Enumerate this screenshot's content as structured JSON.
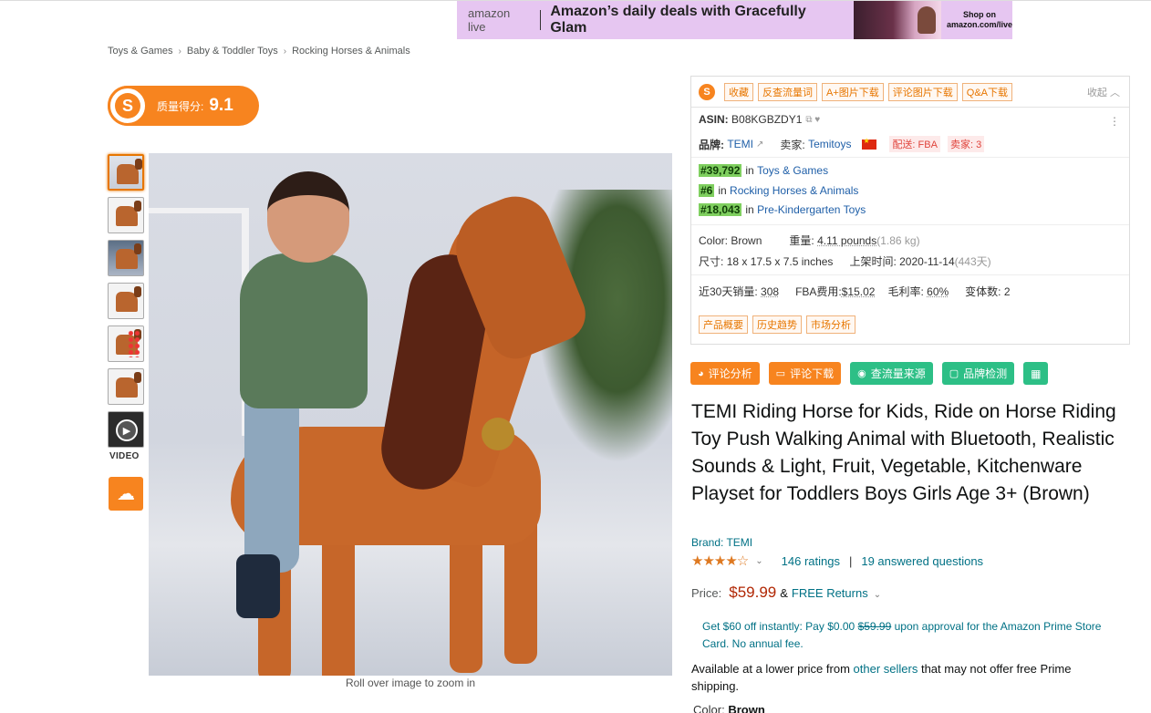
{
  "banner": {
    "brand": "amazon",
    "brand_suffix": "live",
    "text": "Amazon’s daily deals with Gracefully Glam",
    "cta_line1": "Shop on",
    "cta_line2": "amazon.com/live"
  },
  "breadcrumb": [
    "Toys & Games",
    "Baby & Toddler Toys",
    "Rocking Horses & Animals"
  ],
  "breadcrumb_sep": "›",
  "quality": {
    "logo": "S",
    "label": "质量得分:",
    "score": "9.1"
  },
  "thumbnails": {
    "video_label": "VIDEO",
    "download_icon": "cloud-download-icon"
  },
  "image_note": "Roll over image to zoom in",
  "plugin": {
    "logo": "S",
    "tags": [
      "收藏",
      "反查流量词",
      "A+图片下载",
      "评论图片下载",
      "Q&A下载"
    ],
    "collapse": "收起 ︿",
    "asin_label": "ASIN:",
    "asin": "B08KGBZDY1",
    "asin_icons": "⧉ ♥",
    "brand_label": "品牌:",
    "brand": "TEMI",
    "brand_icon": "↗",
    "seller_label": "卖家:",
    "seller": "Temitoys",
    "delivery": "配送: FBA",
    "sellers_count": "卖家: 3",
    "ranks": [
      {
        "rank": "#39,792",
        "in": "in",
        "category": "Toys & Games"
      },
      {
        "rank": "#6",
        "in": "in",
        "category": "Rocking Horses & Animals"
      },
      {
        "rank": "#18,043",
        "in": "in",
        "category": "Pre-Kindergarten Toys"
      }
    ],
    "color_label": "Color:",
    "color": "Brown",
    "weight_label": "重量:",
    "weight": "4.11 pounds",
    "weight_alt": "(1.86 kg)",
    "size_label": "尺寸:",
    "size": "18 x 17.5 x 7.5 inches",
    "listed_label": "上架时间:",
    "listed": "2020-11-14",
    "listed_days": "(443天)",
    "sales_label": "近30天销量:",
    "sales": "308",
    "fba_label": "FBA费用:",
    "fba": "$15.02",
    "margin_label": "毛利率:",
    "margin": "60%",
    "variants_label": "变体数:",
    "variants": "2",
    "bottom_tags": [
      "产品概要",
      "历史趋势",
      "市场分析"
    ],
    "kebab": "⋮"
  },
  "actions": [
    {
      "icon": "◕",
      "label": "评论分析"
    },
    {
      "icon": "▭",
      "label": "评论下载"
    },
    {
      "icon": "◉",
      "label": "查流量来源"
    },
    {
      "icon": "▢",
      "label": "品牌检测"
    },
    {
      "icon": "▦",
      "label": ""
    }
  ],
  "product": {
    "title": "TEMI Riding Horse for Kids, Ride on Horse Riding Toy Push Walking Animal with Bluetooth, Realistic Sounds & Light, Fruit, Vegetable, Kitchenware Playset for Toddlers Boys Girls Age 3+ (Brown)",
    "brand_link": "Brand: TEMI",
    "stars": "★★★★☆",
    "rating_value": 3.5,
    "ratings": "146 ratings",
    "answered": "19 answered questions",
    "price_label": "Price:",
    "price": "$59.99",
    "amp": "&",
    "free_returns": "FREE Returns",
    "promo_prefix": "Get $60 off instantly: Pay $0.00",
    "promo_strike": "$59.99",
    "promo_suffix": "upon approval for the Amazon Prime Store Card. No annual fee.",
    "avail_prefix": "Available at a lower price from",
    "avail_link": "other sellers",
    "avail_suffix": "that may not offer free Prime shipping.",
    "color_label": "Color:",
    "color_value": "Brown"
  },
  "colors": {
    "accent_orange": "#f7841f",
    "accent_green": "#2dbf86",
    "price_red": "#b12704",
    "link": "#007185"
  }
}
